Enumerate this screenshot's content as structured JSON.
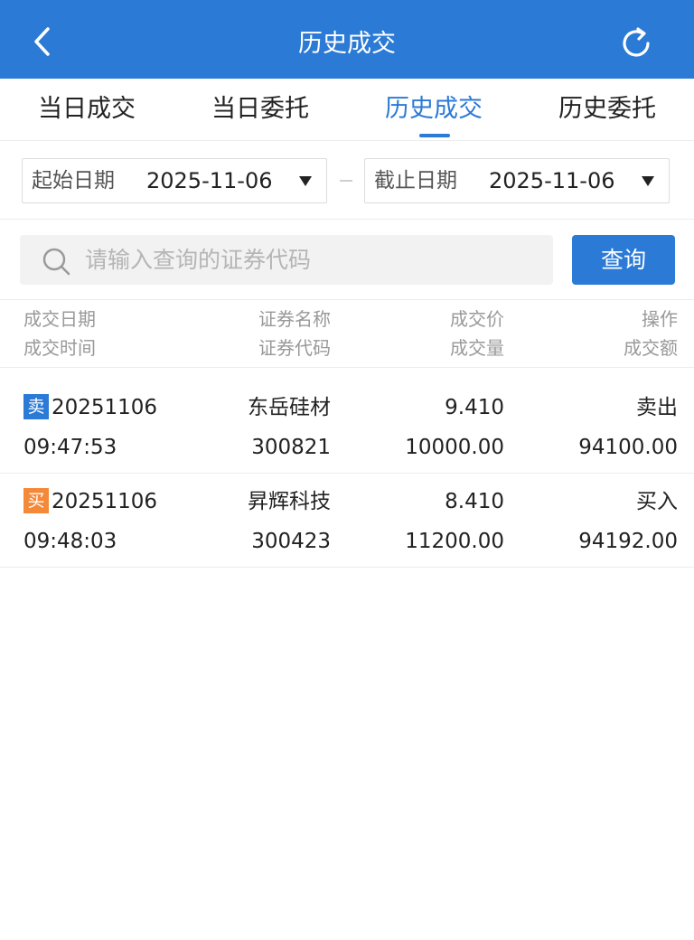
{
  "header": {
    "title": "历史成交",
    "back_icon": "chevron-left-icon",
    "refresh_icon": "refresh-icon",
    "bg_color": "#2b7ad6"
  },
  "tabs": [
    {
      "label": "当日成交",
      "active": false
    },
    {
      "label": "当日委托",
      "active": false
    },
    {
      "label": "历史成交",
      "active": true
    },
    {
      "label": "历史委托",
      "active": false
    }
  ],
  "date_filter": {
    "start_label": "起始日期",
    "start_value": "2025-11-06",
    "end_label": "截止日期",
    "end_value": "2025-11-06"
  },
  "search": {
    "placeholder": "请输入查询的证券代码",
    "value": "",
    "button_label": "查询"
  },
  "columns": {
    "col1_top": "成交日期",
    "col1_bottom": "成交时间",
    "col2_top": "证券名称",
    "col2_bottom": "证券代码",
    "col3_top": "成交价",
    "col3_bottom": "成交量",
    "col4_top": "操作",
    "col4_bottom": "成交额"
  },
  "trades": [
    {
      "badge": "卖",
      "badge_color": "#2b7ad6",
      "date": "20251106",
      "time": "09:47:53",
      "name": "东岳硅材",
      "code": "300821",
      "price": "9.410",
      "volume": "10000.00",
      "action": "卖出",
      "amount": "94100.00"
    },
    {
      "badge": "买",
      "badge_color": "#f5893a",
      "date": "20251106",
      "time": "09:48:03",
      "name": "昇辉科技",
      "code": "300423",
      "price": "8.410",
      "volume": "11200.00",
      "action": "买入",
      "amount": "94192.00"
    }
  ]
}
